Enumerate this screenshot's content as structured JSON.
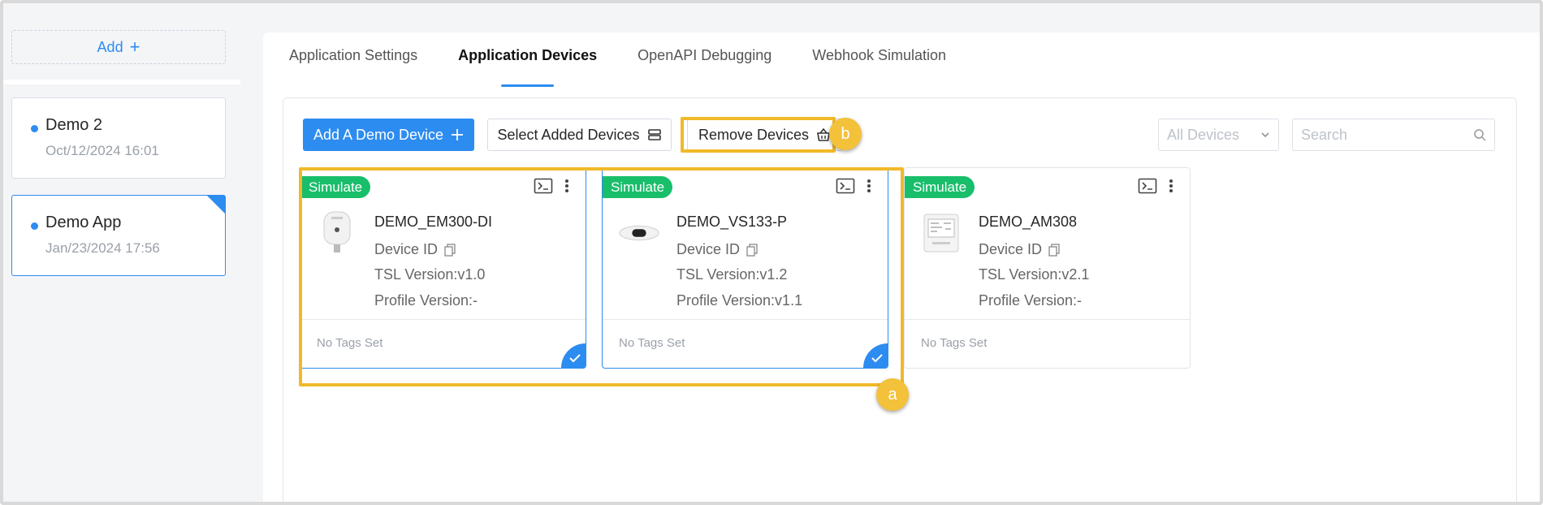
{
  "sidebar": {
    "add_label": "Add",
    "apps": [
      {
        "name": "Demo 2",
        "date": "Oct/12/2024 16:01"
      },
      {
        "name": "Demo App",
        "date": "Jan/23/2024 17:56"
      }
    ]
  },
  "tabs": [
    {
      "label": "Application Settings"
    },
    {
      "label": "Application Devices"
    },
    {
      "label": "OpenAPI Debugging"
    },
    {
      "label": "Webhook Simulation"
    }
  ],
  "toolbar": {
    "add_demo_label": "Add A Demo Device",
    "select_added_label": "Select Added Devices",
    "remove_label": "Remove Devices",
    "filter_value": "All Devices",
    "search_placeholder": "Search"
  },
  "devices": [
    {
      "tag": "Simulate",
      "name": "DEMO_EM300-DI",
      "device_id": "Device ID",
      "tsl": "TSL Version:v1.0",
      "profile": "Profile Version:-",
      "tags": "No Tags Set",
      "selected": true
    },
    {
      "tag": "Simulate",
      "name": "DEMO_VS133-P",
      "device_id": "Device ID",
      "tsl": "TSL Version:v1.2",
      "profile": "Profile Version:v1.1",
      "tags": "No Tags Set",
      "selected": true
    },
    {
      "tag": "Simulate",
      "name": "DEMO_AM308",
      "device_id": "Device ID",
      "tsl": "TSL Version:v2.1",
      "profile": "Profile Version:-",
      "tags": "No Tags Set",
      "selected": false
    }
  ],
  "annotations": {
    "a": "a",
    "b": "b"
  },
  "colors": {
    "accent": "#2d8cf0",
    "simulate": "#19be6b",
    "highlight": "#f0b92a"
  },
  "icons": [
    "plus-icon",
    "list-icon",
    "basket-icon",
    "chevron-down-icon",
    "search-icon",
    "terminal-icon",
    "more-icon",
    "copy-icon",
    "check-icon"
  ]
}
